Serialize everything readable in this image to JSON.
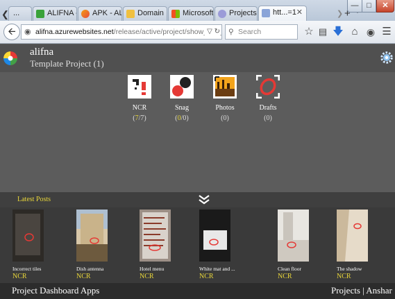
{
  "browser": {
    "tabs": [
      {
        "label": "..."
      },
      {
        "label": "ALIFNA - ..."
      },
      {
        "label": "APK - ALI..."
      },
      {
        "label": "Domain ..."
      },
      {
        "label": "Microsoft..."
      },
      {
        "label": "Projects"
      },
      {
        "label": "htt...=1",
        "active": true
      }
    ],
    "url_host": "alifna.azurewebsites.net",
    "url_path": "/release/active/project/show_my_modules.as",
    "search_placeholder": "Search"
  },
  "app": {
    "name": "alifna",
    "project": "Template Project (1)"
  },
  "modules": [
    {
      "name": "NCR",
      "count_open": "7",
      "count_total": "7",
      "count_text": "",
      "icon": "ncr-icon"
    },
    {
      "name": "Snag",
      "count_open": "0",
      "count_total": "0",
      "count_text": "",
      "icon": "snag-icon"
    },
    {
      "name": "Photos",
      "count_text": "(0)",
      "icon": "photos-icon"
    },
    {
      "name": "Drafts",
      "count_text": "(0)",
      "icon": "drafts-icon"
    }
  ],
  "latest": {
    "title": "Latest Posts"
  },
  "posts": [
    {
      "caption": "Incorrect tiles",
      "type": "NCR"
    },
    {
      "caption": "Dish antenna",
      "type": "NCR"
    },
    {
      "caption": "Hotel menu",
      "type": "NCR"
    },
    {
      "caption": "White mat and ...",
      "type": "NCR"
    },
    {
      "caption": "Clean floor",
      "type": "NCR"
    },
    {
      "caption": "The shadow",
      "type": "NCR"
    }
  ],
  "footer": {
    "title": "Project Dashboard Apps",
    "links": "Projects |  Anshar"
  },
  "colors": {
    "accent_yellow": "#e8d63a",
    "header_bg": "#505050",
    "footer_bg": "#2c2c2c"
  }
}
